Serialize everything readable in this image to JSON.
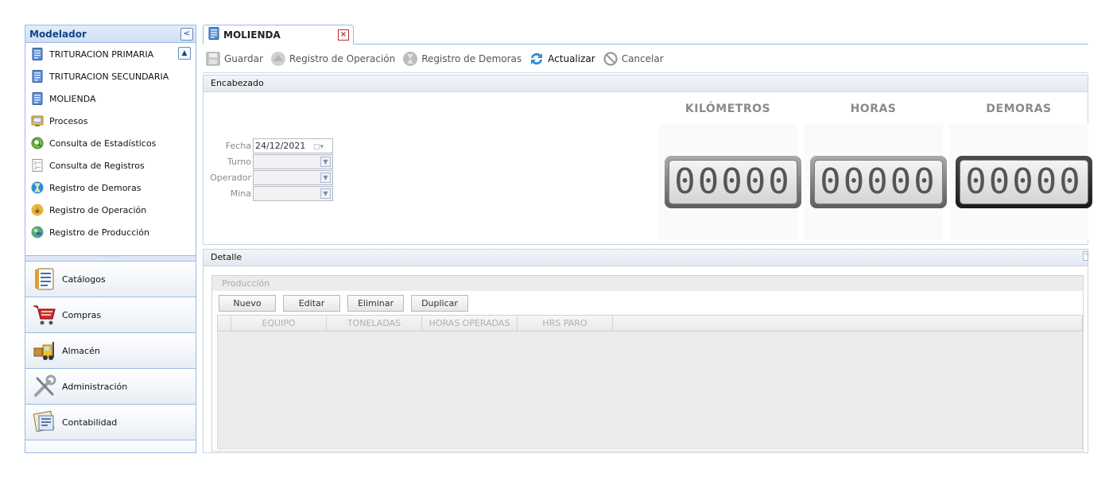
{
  "sidebar": {
    "title": "Modelador",
    "collapse_glyph": "<",
    "items": [
      {
        "label": "TRITURACION PRIMARIA",
        "icon": "document-icon"
      },
      {
        "label": "TRITURACION SECUNDARIA",
        "icon": "document-icon"
      },
      {
        "label": "MOLIENDA",
        "icon": "document-icon"
      },
      {
        "label": "Procesos",
        "icon": "process-icon"
      },
      {
        "label": "Consulta de Estadísticos",
        "icon": "chart-search-icon"
      },
      {
        "label": "Consulta de Registros",
        "icon": "records-icon"
      },
      {
        "label": "Registro de Demoras",
        "icon": "hourglass-icon"
      },
      {
        "label": "Registro de Operación",
        "icon": "operation-icon"
      },
      {
        "label": "Registro de Producción",
        "icon": "production-icon"
      }
    ],
    "splitter_dots": "·······",
    "groups": [
      {
        "label": "Catálogos",
        "icon": "catalog-icon"
      },
      {
        "label": "Compras",
        "icon": "shopping-cart-icon"
      },
      {
        "label": "Almacén",
        "icon": "forklift-icon"
      },
      {
        "label": "Administración",
        "icon": "tools-icon"
      },
      {
        "label": "Contabilidad",
        "icon": "accounting-icon"
      }
    ]
  },
  "tab": {
    "label": "MOLIENDA",
    "close_glyph": "×"
  },
  "toolbar": {
    "guardar": "Guardar",
    "registro_operacion": "Registro de Operación",
    "registro_demoras": "Registro de Demoras",
    "actualizar": "Actualizar",
    "cancelar": "Cancelar"
  },
  "encabezado": {
    "title": "Encabezado",
    "fields": {
      "fecha_label": "Fecha",
      "fecha_value": "24/12/2021",
      "turno_label": "Turno",
      "turno_value": "",
      "operador_label": "Operador",
      "operador_value": "",
      "mina_label": "Mina",
      "mina_value": ""
    },
    "counters": [
      {
        "title": "KILÓMETROS",
        "value": "00000"
      },
      {
        "title": "HORAS",
        "value": "00000"
      },
      {
        "title": "DEMORAS",
        "value": "00000"
      }
    ]
  },
  "detalle": {
    "title": "Detalle",
    "produccion_title": "Producción",
    "buttons": {
      "nuevo": "Nuevo",
      "editar": "Editar",
      "eliminar": "Eliminar",
      "duplicar": "Duplicar"
    },
    "columns": [
      "EQUIPO",
      "TONELADAS",
      "HORAS OPERADAS",
      "HRS PARO"
    ]
  }
}
